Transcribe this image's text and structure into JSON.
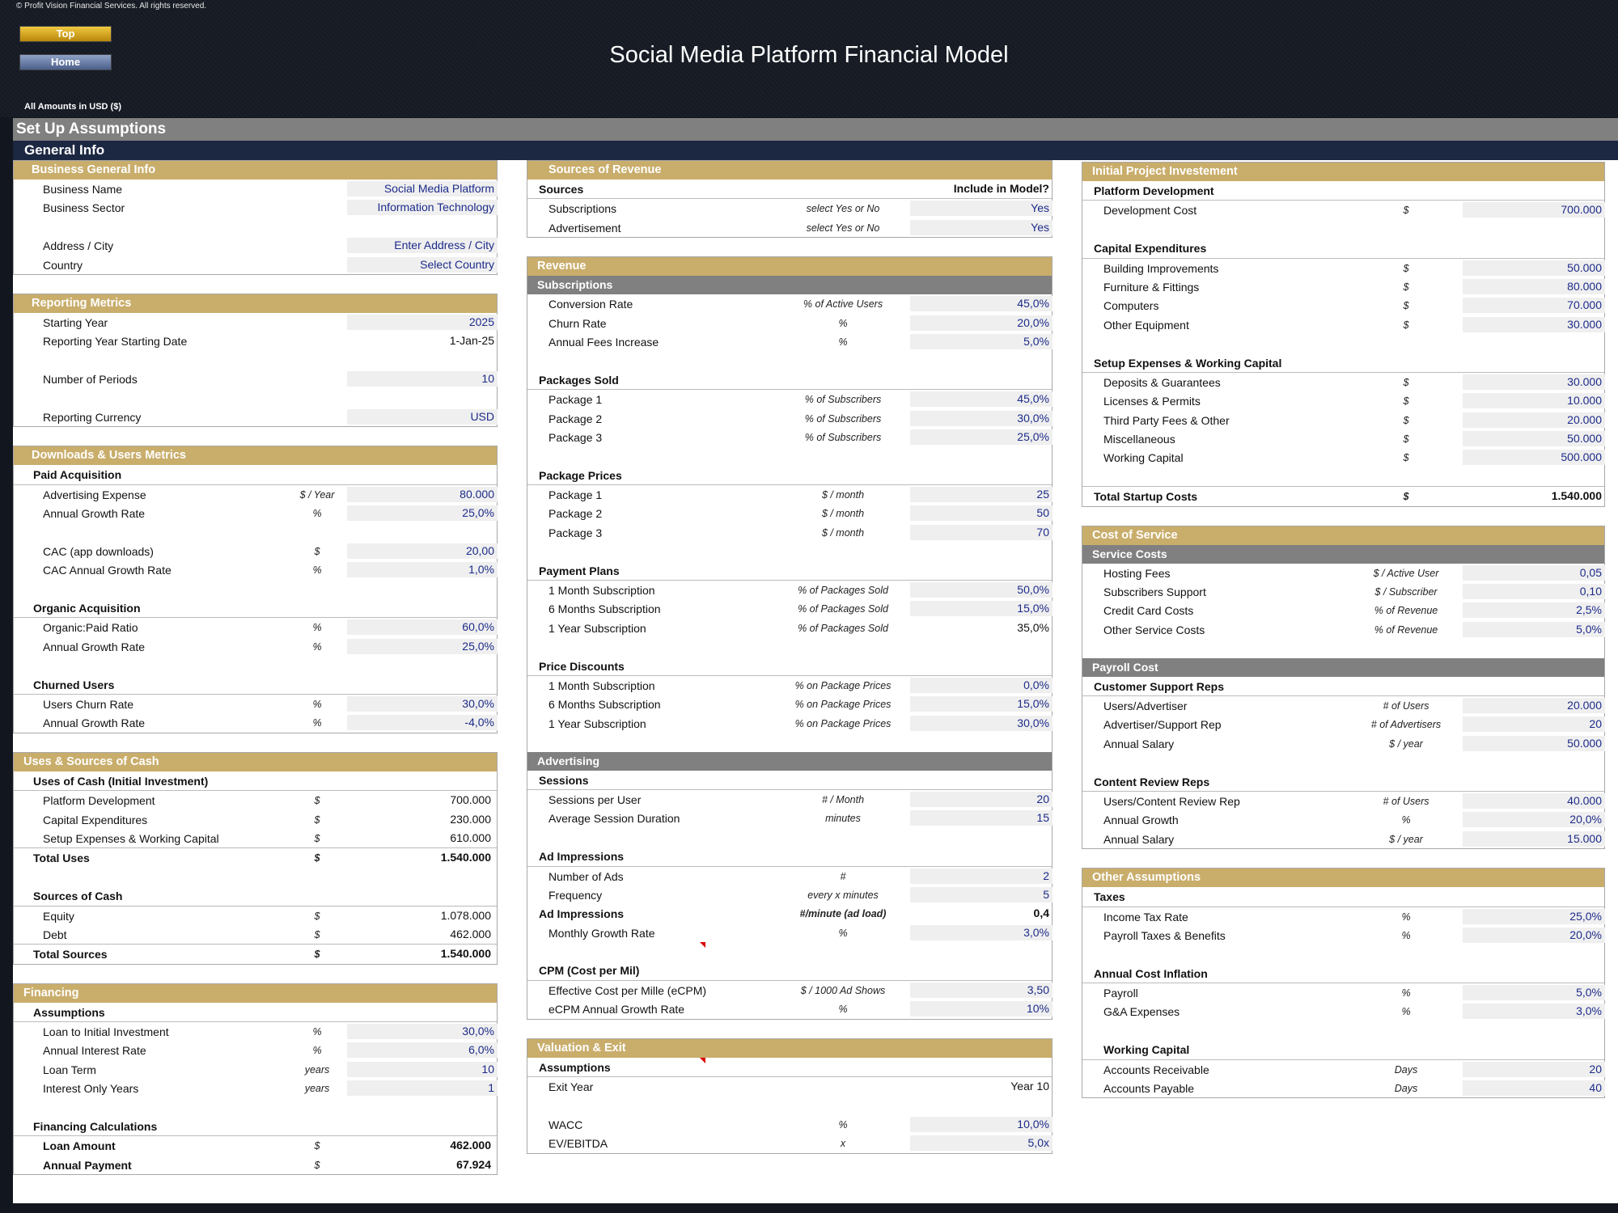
{
  "header": {
    "copyright": "© Profit Vision Financial Services. All rights reserved.",
    "top_button": "Top",
    "home_button": "Home",
    "title": "Social Media Platform Financial Model",
    "amounts_label": "All Amounts in  USD ($)",
    "setup_title": "Set Up Assumptions",
    "general_title": "General Info"
  },
  "business": {
    "title": "Business General Info",
    "name_label": "Business Name",
    "name": "Social Media Platform",
    "sector_label": "Business Sector",
    "sector": "Information Technology",
    "address_label": "Address / City",
    "address": "Enter Address / City",
    "country_label": "Country",
    "country": "Select Country"
  },
  "reporting": {
    "title": "Reporting Metrics",
    "rows": [
      {
        "label": "Starting Year",
        "value": "2025"
      },
      {
        "label": "Reporting Year Starting Date",
        "value": "1-Jan-25"
      },
      {
        "label": "Number of Periods",
        "value": "10"
      },
      {
        "label": "Reporting Currency",
        "value": "USD"
      }
    ]
  },
  "downloads": {
    "title": "Downloads & Users Metrics",
    "paid": "Paid Acquisition",
    "organic": "Organic Acquisition",
    "churned": "Churned Users",
    "rows": [
      {
        "label": "Advertising Expense",
        "unit": "$ / Year",
        "value": "80.000"
      },
      {
        "label": "Annual Growth Rate",
        "unit": "%",
        "value": "25,0%"
      },
      {
        "label": "CAC (app downloads)",
        "unit": "$",
        "value": "20,00"
      },
      {
        "label": "CAC Annual Growth Rate",
        "unit": "%",
        "value": "1,0%"
      },
      {
        "label": "Organic:Paid Ratio",
        "unit": "%",
        "value": "60,0%"
      },
      {
        "label": "Annual Growth Rate",
        "unit": "%",
        "value": "25,0%"
      },
      {
        "label": "Users Churn Rate",
        "unit": "%",
        "value": "30,0%"
      },
      {
        "label": "Annual Growth Rate",
        "unit": "%",
        "value": "-4,0%"
      }
    ]
  },
  "uses": {
    "title": "Uses & Sources of Cash",
    "uses_head": "Uses of Cash (Initial Investment)",
    "sources_head": "Sources of Cash",
    "rows": [
      {
        "label": "Platform Development",
        "unit": "$",
        "value": "700.000"
      },
      {
        "label": "Capital Expenditures",
        "unit": "$",
        "value": "230.000"
      },
      {
        "label": "Setup Expenses & Working Capital",
        "unit": "$",
        "value": "610.000"
      },
      {
        "label": "Total Uses",
        "unit": "$",
        "value": "1.540.000"
      },
      {
        "label": "Equity",
        "unit": "$",
        "value": "1.078.000"
      },
      {
        "label": "Debt",
        "unit": "$",
        "value": "462.000"
      },
      {
        "label": "Total Sources",
        "unit": "$",
        "value": "1.540.000"
      }
    ]
  },
  "financing": {
    "title": "Financing",
    "assumptions": "Assumptions",
    "calc_head": "Financing Calculations",
    "rows": [
      {
        "label": "Loan to Initial Investment",
        "unit": "%",
        "value": "30,0%"
      },
      {
        "label": "Annual Interest Rate",
        "unit": "%",
        "value": "6,0%"
      },
      {
        "label": "Loan Term",
        "unit": "years",
        "value": "10"
      },
      {
        "label": "Interest Only Years",
        "unit": "years",
        "value": "1"
      },
      {
        "label": "Loan Amount",
        "unit": "$",
        "value": "462.000"
      },
      {
        "label": "Annual Payment",
        "unit": "$",
        "value": "67.924"
      }
    ]
  },
  "sources_rev": {
    "title": "Sources of Revenue",
    "sources": "Sources",
    "include": "Include in Model?",
    "rows": [
      {
        "label": "Subscriptions",
        "unit": "select Yes or No",
        "value": "Yes"
      },
      {
        "label": "Advertisement",
        "unit": "select Yes or No",
        "value": "Yes"
      }
    ]
  },
  "revenue": {
    "title": "Revenue",
    "subscriptions": "Subscriptions",
    "packages_sold": "Packages Sold",
    "package_prices": "Package Prices",
    "payment_plans": "Payment Plans",
    "price_discounts": "Price Discounts",
    "rows": [
      {
        "label": "Conversion Rate",
        "unit": "% of Active Users",
        "value": "45,0%"
      },
      {
        "label": "Churn Rate",
        "unit": "%",
        "value": "20,0%"
      },
      {
        "label": "Annual Fees Increase",
        "unit": "%",
        "value": "5,0%"
      },
      {
        "label": "Package 1",
        "unit": "% of Subscribers",
        "value": "45,0%"
      },
      {
        "label": "Package 2",
        "unit": "% of Subscribers",
        "value": "30,0%"
      },
      {
        "label": "Package 3",
        "unit": "% of Subscribers",
        "value": "25,0%"
      },
      {
        "label": "Package 1",
        "unit": "$ / month",
        "value": "25"
      },
      {
        "label": "Package 2",
        "unit": "$ / month",
        "value": "50"
      },
      {
        "label": "Package 3",
        "unit": "$ / month",
        "value": "70"
      },
      {
        "label": "1 Month Subscription",
        "unit": "% of Packages Sold",
        "value": "50,0%"
      },
      {
        "label": "6 Months Subscription",
        "unit": "% of Packages Sold",
        "value": "15,0%"
      },
      {
        "label": "1 Year Subscription",
        "unit": "% of Packages Sold",
        "value": "35,0%"
      },
      {
        "label": "1 Month Subscription",
        "unit": "% on Package Prices",
        "value": "0,0%"
      },
      {
        "label": "6 Months Subscription",
        "unit": "% on Package Prices",
        "value": "15,0%"
      },
      {
        "label": "1 Year Subscription",
        "unit": "% on Package Prices",
        "value": "30,0%"
      }
    ]
  },
  "advertising": {
    "title": "Advertising",
    "sessions": "Sessions",
    "ad_impressions_head": "Ad Impressions",
    "cpm_head": "CPM (Cost per Mil)",
    "rows": [
      {
        "label": "Sessions per User",
        "unit": "# / Month",
        "value": "20"
      },
      {
        "label": "Average Session Duration",
        "unit": "minutes",
        "value": "15"
      },
      {
        "label": "Number of Ads",
        "unit": "#",
        "value": "2"
      },
      {
        "label": "Frequency",
        "unit": "every x minutes",
        "value": "5"
      },
      {
        "label": "Ad Impressions",
        "unit": "#/minute (ad load)",
        "value": "0,4"
      },
      {
        "label": "Monthly Growth Rate",
        "unit": "%",
        "value": "3,0%"
      },
      {
        "label": "Effective Cost per Mille (eCPM)",
        "unit": "$ / 1000 Ad Shows",
        "value": "3,50"
      },
      {
        "label": "eCPM Annual Growth Rate",
        "unit": "%",
        "value": "10%"
      }
    ]
  },
  "valuation": {
    "title": "Valuation & Exit",
    "assumptions": "Assumptions",
    "rows": [
      {
        "label": "Exit Year",
        "unit": "",
        "value": "Year 10"
      },
      {
        "label": "WACC",
        "unit": "%",
        "value": "10,0%"
      },
      {
        "label": "EV/EBITDA",
        "unit": "x",
        "value": "5,0x"
      }
    ]
  },
  "investment": {
    "title": "Initial Project Investement",
    "platform": "Platform Development",
    "capex": "Capital Expenditures",
    "setup": "Setup Expenses & Working Capital",
    "rows": [
      {
        "label": "Development Cost",
        "unit": "$",
        "value": "700.000"
      },
      {
        "label": "Building Improvements",
        "unit": "$",
        "value": "50.000"
      },
      {
        "label": "Furniture & Fittings",
        "unit": "$",
        "value": "80.000"
      },
      {
        "label": "Computers",
        "unit": "$",
        "value": "70.000"
      },
      {
        "label": "Other Equipment",
        "unit": "$",
        "value": "30.000"
      },
      {
        "label": "Deposits & Guarantees",
        "unit": "$",
        "value": "30.000"
      },
      {
        "label": "Licenses & Permits",
        "unit": "$",
        "value": "10.000"
      },
      {
        "label": "Third Party Fees & Other",
        "unit": "$",
        "value": "20.000"
      },
      {
        "label": "Miscellaneous",
        "unit": "$",
        "value": "50.000"
      },
      {
        "label": "Working Capital",
        "unit": "$",
        "value": "500.000"
      },
      {
        "label": "Total Startup Costs",
        "unit": "$",
        "value": "1.540.000"
      }
    ]
  },
  "cost_service": {
    "title": "Cost of Service",
    "service_costs": "Service Costs",
    "rows": [
      {
        "label": "Hosting Fees",
        "unit": "$ / Active User",
        "value": "0,05"
      },
      {
        "label": "Subscribers Support",
        "unit": "$ / Subscriber",
        "value": "0,10"
      },
      {
        "label": "Credit Card Costs",
        "unit": "% of Revenue",
        "value": "2,5%"
      },
      {
        "label": "Other Service Costs",
        "unit": "% of Revenue",
        "value": "5,0%"
      }
    ]
  },
  "payroll": {
    "title": "Payroll Cost",
    "support_head": "Customer Support Reps",
    "content_head": "Content Review Reps",
    "rows": [
      {
        "label": "Users/Advertiser",
        "unit": "# of Users",
        "value": "20.000"
      },
      {
        "label": "Advertiser/Support Rep",
        "unit": "# of Advertisers",
        "value": "20"
      },
      {
        "label": "Annual Salary",
        "unit": "$ / year",
        "value": "50.000"
      },
      {
        "label": "Users/Content Review Rep",
        "unit": "# of Users",
        "value": "40.000"
      },
      {
        "label": "Annual Growth",
        "unit": "%",
        "value": "20,0%"
      },
      {
        "label": "Annual Salary",
        "unit": "$ / year",
        "value": "15.000"
      }
    ]
  },
  "other": {
    "title": "Other Assumptions",
    "taxes": "Taxes",
    "inflation": "Annual Cost Inflation",
    "working_capital": "Working Capital",
    "rows": [
      {
        "label": "Income Tax Rate",
        "unit": "%",
        "value": "25,0%"
      },
      {
        "label": "Payroll Taxes & Benefits",
        "unit": "%",
        "value": "20,0%"
      },
      {
        "label": "Payroll",
        "unit": "%",
        "value": "5,0%"
      },
      {
        "label": "G&A Expenses",
        "unit": "%",
        "value": "3,0%"
      },
      {
        "label": "Accounts Receivable",
        "unit": "Days",
        "value": "20"
      },
      {
        "label": "Accounts Payable",
        "unit": "Days",
        "value": "40"
      }
    ]
  }
}
